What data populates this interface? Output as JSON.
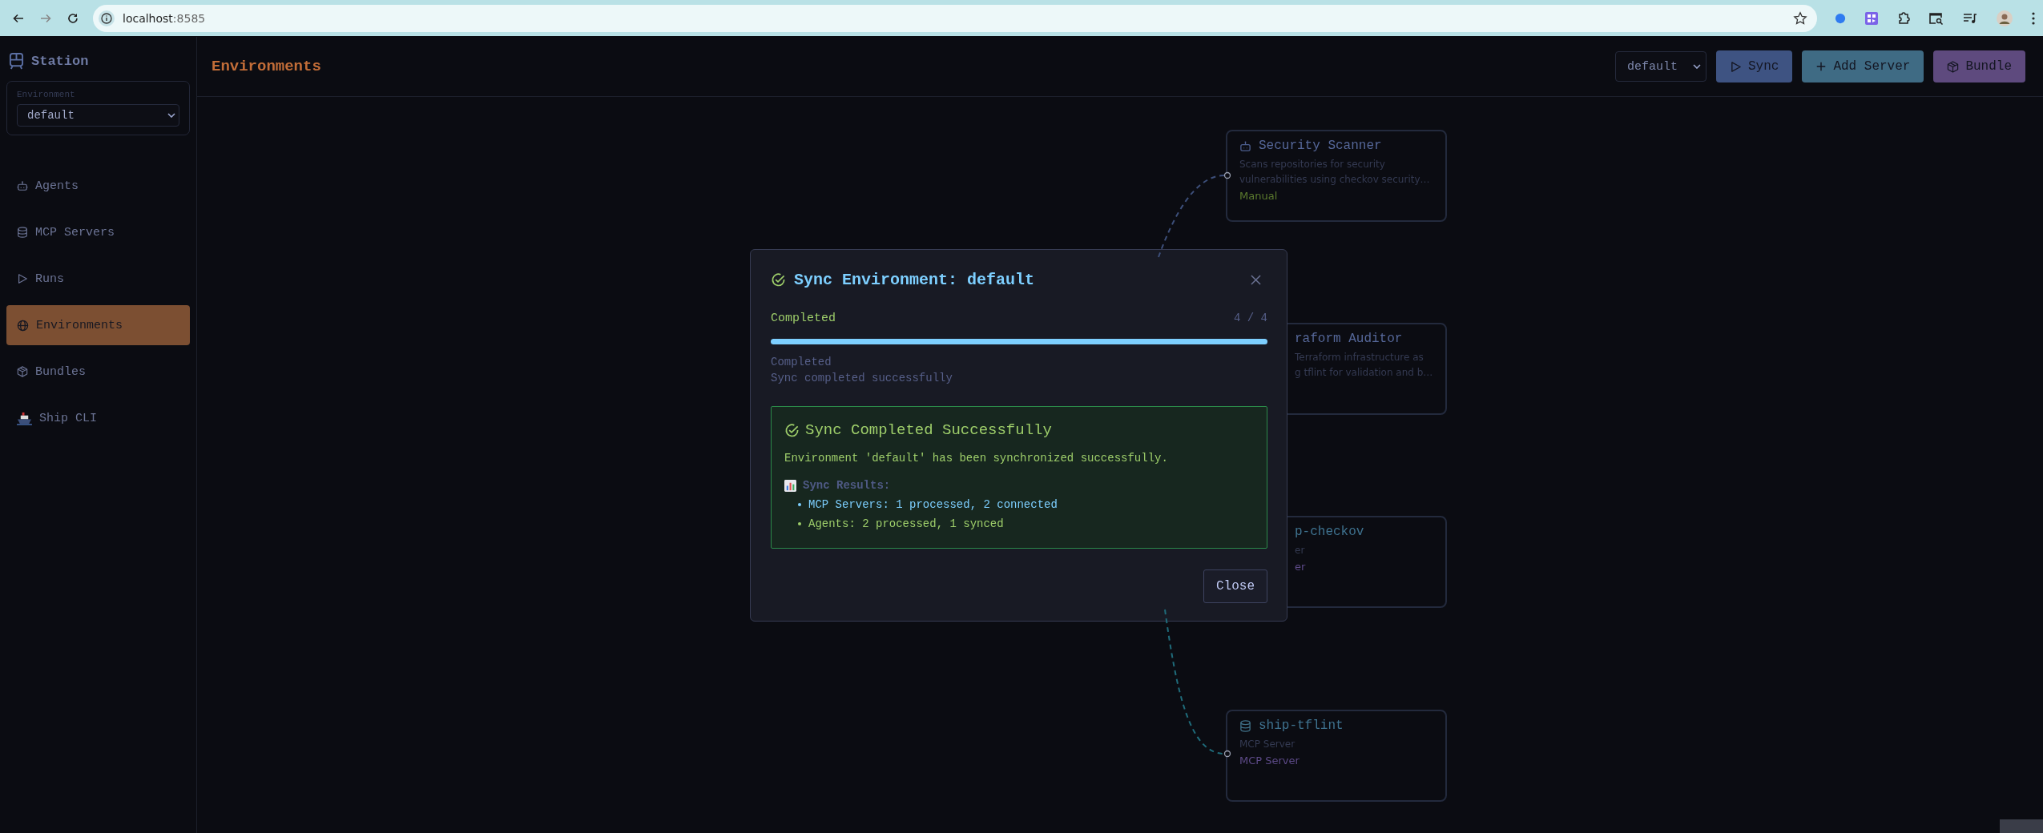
{
  "browser": {
    "url_host": "localhost",
    "url_port": ":8585"
  },
  "sidebar": {
    "title": "Station",
    "environment_label": "Environment",
    "environment_value": "default",
    "items": [
      {
        "label": "Agents",
        "selected": false
      },
      {
        "label": "MCP Servers",
        "selected": false
      },
      {
        "label": "Runs",
        "selected": false
      },
      {
        "label": "Environments",
        "selected": true
      },
      {
        "label": "Bundles",
        "selected": false
      },
      {
        "label": "Ship CLI",
        "selected": false
      }
    ]
  },
  "header": {
    "title": "Environments",
    "environment_value": "default",
    "buttons": [
      {
        "label": "Sync",
        "kind": "sync"
      },
      {
        "label": "Add Server",
        "kind": "add"
      },
      {
        "label": "Bundle",
        "kind": "bundle"
      }
    ]
  },
  "canvas": {
    "nodes": [
      {
        "kind": "agent",
        "title": "Security Scanner",
        "description": [
          "Scans repositories for security",
          "vulnerabilities using checkov security…"
        ],
        "tag": "Manual",
        "partly_covered": false
      },
      {
        "kind": "agent",
        "title": "raform Auditor",
        "description": [
          "Terraform infrastructure as",
          "g tflint for validation and b…"
        ],
        "partly_covered": true
      },
      {
        "kind": "mcp_server",
        "title": "p-checkov",
        "description": [
          "er"
        ],
        "tag": "er",
        "partly_covered": true
      },
      {
        "kind": "mcp_server",
        "title": "ship-tflint",
        "description": [
          "MCP Server"
        ],
        "tag": "MCP Server",
        "partly_covered": false
      }
    ]
  },
  "modal": {
    "title": "Sync Environment: default",
    "status": "Completed",
    "progress_text": "4 / 4",
    "level": 1,
    "messages": [
      "Completed",
      "Sync completed successfully"
    ],
    "success": {
      "title": "Sync Completed Successfully",
      "text": "Environment 'default' has been synchronized successfully.",
      "results_label": "Sync Results:",
      "results": [
        {
          "text": "MCP Servers: 1 processed, 2 connected",
          "color": "#7dcfff"
        },
        {
          "text": "Agents: 2 processed, 1 synced",
          "color": "#9ece6a"
        }
      ]
    },
    "close_label": "Close"
  }
}
